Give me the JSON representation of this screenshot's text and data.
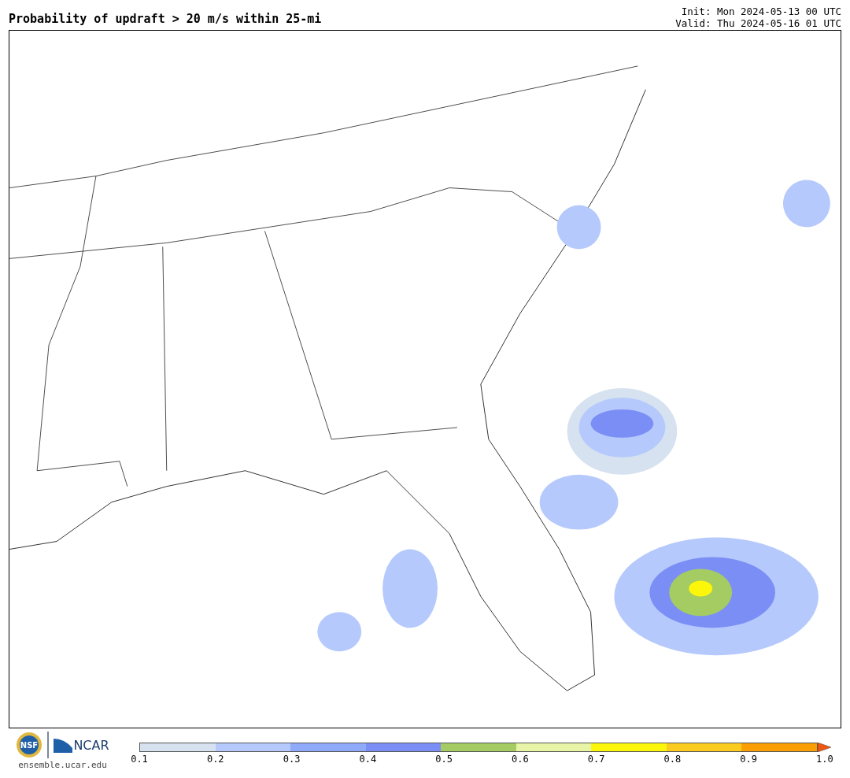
{
  "title": "Probability of updraft > 20 m/s within 25-mi",
  "init": "Init: Mon 2024-05-13 00 UTC",
  "valid": "Valid: Thu 2024-05-16 01 UTC",
  "logos": {
    "nsf": "NSF",
    "ncar": "NCAR",
    "site": "ensemble.ucar.edu"
  },
  "colorbar": {
    "segments": [
      {
        "color": "#d6e2ef"
      },
      {
        "color": "#b5c9fc"
      },
      {
        "color": "#8eaaf9"
      },
      {
        "color": "#7b8ef5"
      },
      {
        "color": "#a4cc62"
      },
      {
        "color": "#e8f5a6"
      },
      {
        "color": "#fcf60a"
      },
      {
        "color": "#fccb20"
      },
      {
        "color": "#fb9d04"
      }
    ],
    "extend": {
      "color": "#f05512"
    },
    "ticks": [
      "0.1",
      "0.2",
      "0.3",
      "0.4",
      "0.5",
      "0.6",
      "0.7",
      "0.8",
      "0.9",
      "1.0"
    ]
  }
}
